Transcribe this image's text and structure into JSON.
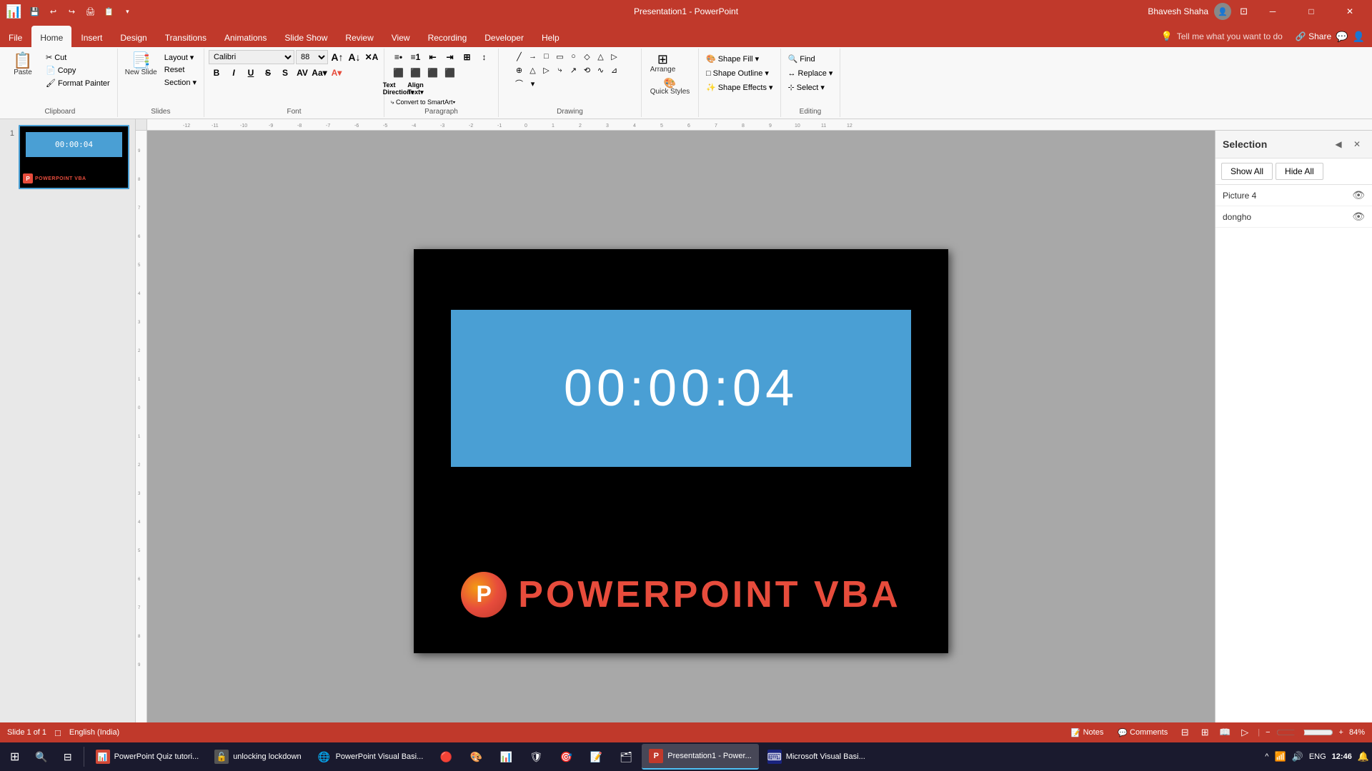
{
  "titlebar": {
    "title": "Presentation1 - PowerPoint",
    "user": "Bhavesh Shaha",
    "quickaccess": [
      "💾",
      "↩",
      "↪",
      "🖨",
      "📋",
      "↗"
    ]
  },
  "ribbon": {
    "tabs": [
      "File",
      "Home",
      "Insert",
      "Design",
      "Transitions",
      "Animations",
      "Slide Show",
      "Review",
      "View",
      "Recording",
      "Developer",
      "Help"
    ],
    "active_tab": "Home",
    "groups": {
      "clipboard": {
        "label": "Clipboard",
        "paste_label": "Paste",
        "cut_label": "Cut",
        "copy_label": "Copy",
        "format_painter_label": "Format Painter"
      },
      "slides": {
        "label": "Slides",
        "new_slide_label": "New Slide",
        "layout_label": "Layout",
        "reset_label": "Reset",
        "section_label": "Section"
      },
      "font": {
        "label": "Font",
        "font_name": "Calibri",
        "font_size": "88",
        "bold": "B",
        "italic": "I",
        "underline": "U",
        "strikethrough": "S"
      },
      "paragraph": {
        "label": "Paragraph"
      },
      "drawing": {
        "label": "Drawing",
        "arrange_label": "Arrange",
        "quick_styles_label": "Quick Styles",
        "shape_fill_label": "Shape Fill",
        "shape_outline_label": "Shape Outline",
        "shape_effects_label": "Shape Effects"
      },
      "editing": {
        "label": "Editing",
        "find_label": "Find",
        "replace_label": "Replace",
        "select_label": "Select"
      }
    }
  },
  "tell_me": {
    "placeholder": "Tell me what you want to do"
  },
  "slide": {
    "number": "1",
    "timer_text": "00:00:04",
    "brand_text": "POWERPOINT VBA",
    "brand_letter": "P"
  },
  "selection_panel": {
    "title": "Selection",
    "show_all_label": "Show All",
    "hide_all_label": "Hide All",
    "items": [
      {
        "name": "Picture 4",
        "visible": true
      },
      {
        "name": "dongho",
        "visible": true
      }
    ]
  },
  "status_bar": {
    "slide_info": "Slide 1 of 1",
    "language": "English (India)",
    "notes_label": "Notes",
    "comments_label": "Comments",
    "zoom": "84%"
  },
  "taskbar": {
    "start_icon": "⊞",
    "search_icon": "🔍",
    "apps": [
      {
        "icon": "🖥",
        "label": "PowerPoint Quiz tutori..."
      },
      {
        "icon": "🔓",
        "label": "unlocking lockdown",
        "active": false
      },
      {
        "icon": "🌐",
        "label": "PowerPoint Visual Basi...",
        "color": "#4a86c8"
      },
      {
        "icon": "🔴",
        "label": ""
      },
      {
        "icon": "🎨",
        "label": ""
      },
      {
        "icon": "📊",
        "label": ""
      },
      {
        "icon": "🛡",
        "label": ""
      },
      {
        "icon": "🎯",
        "label": ""
      },
      {
        "icon": "📝",
        "label": ""
      },
      {
        "icon": "🗂",
        "label": ""
      },
      {
        "icon": "📋",
        "label": "Presentation1 - Power...",
        "active": true
      },
      {
        "icon": "⌨",
        "label": "Microsoft Visual Basi..."
      }
    ],
    "time": "12:46",
    "date": "",
    "lang": "ENG"
  }
}
